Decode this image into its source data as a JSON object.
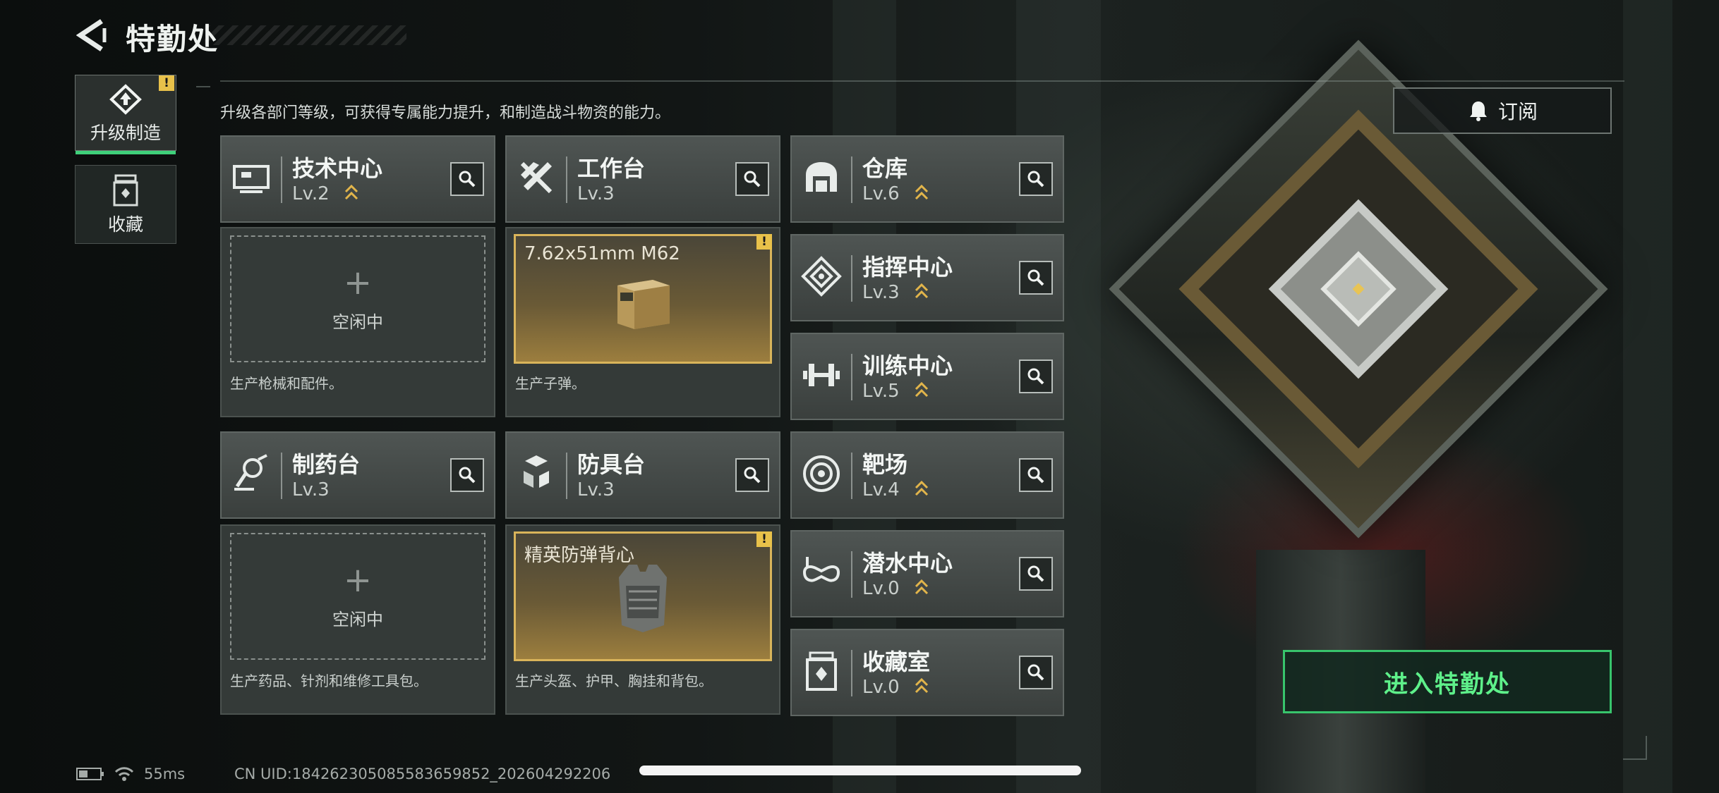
{
  "header": {
    "title": "特勤处",
    "back_icon": "back-chevron-icon"
  },
  "sidebar": {
    "tabs": [
      {
        "label": "升级制造",
        "icon": "upgrade-icon",
        "active": true,
        "warning": "!"
      },
      {
        "label": "收藏",
        "icon": "collection-icon",
        "active": false
      }
    ]
  },
  "description": "升级各部门等级，可获得专属能力提升，和制造战斗物资的能力。",
  "subscribe": {
    "label": "订阅",
    "icon": "bell-icon"
  },
  "departments": [
    {
      "name": "技术中心",
      "level": "Lv.2",
      "upgradable": true,
      "icon": "tech-center-icon"
    },
    {
      "name": "工作台",
      "level": "Lv.3",
      "upgradable": false,
      "icon": "workbench-icon"
    },
    {
      "name": "仓库",
      "level": "Lv.6",
      "upgradable": true,
      "icon": "warehouse-icon"
    },
    {
      "name": "指挥中心",
      "level": "Lv.3",
      "upgradable": true,
      "icon": "command-center-icon"
    },
    {
      "name": "训练中心",
      "level": "Lv.5",
      "upgradable": true,
      "icon": "training-center-icon"
    },
    {
      "name": "制药台",
      "level": "Lv.3",
      "upgradable": false,
      "icon": "pharmacy-icon"
    },
    {
      "name": "防具台",
      "level": "Lv.3",
      "upgradable": false,
      "icon": "armor-bench-icon"
    },
    {
      "name": "靶场",
      "level": "Lv.4",
      "upgradable": true,
      "icon": "shooting-range-icon"
    },
    {
      "name": "潜水中心",
      "level": "Lv.0",
      "upgradable": true,
      "icon": "diving-center-icon"
    },
    {
      "name": "收藏室",
      "level": "Lv.0",
      "upgradable": true,
      "icon": "collection-room-icon"
    }
  ],
  "production": [
    {
      "status": "空闲中",
      "description": "生产枪械和配件。"
    },
    {
      "item": "7.62x51mm M62",
      "warning": "!",
      "description": "生产子弹。"
    },
    {
      "status": "空闲中",
      "description": "生产药品、针剂和维修工具包。"
    },
    {
      "item": "精英防弹背心",
      "warning": "!",
      "description": "生产头盔、护甲、胸挂和背包。"
    }
  ],
  "enter_button": "进入特勤处",
  "status_bar": {
    "ping": "55ms",
    "uid": "CN UID:18426230508558365985​2_202604292206"
  },
  "colors": {
    "accent_green": "#38c46c",
    "warning_yellow": "#e8c14a",
    "gold_border": "#d9b45a"
  }
}
